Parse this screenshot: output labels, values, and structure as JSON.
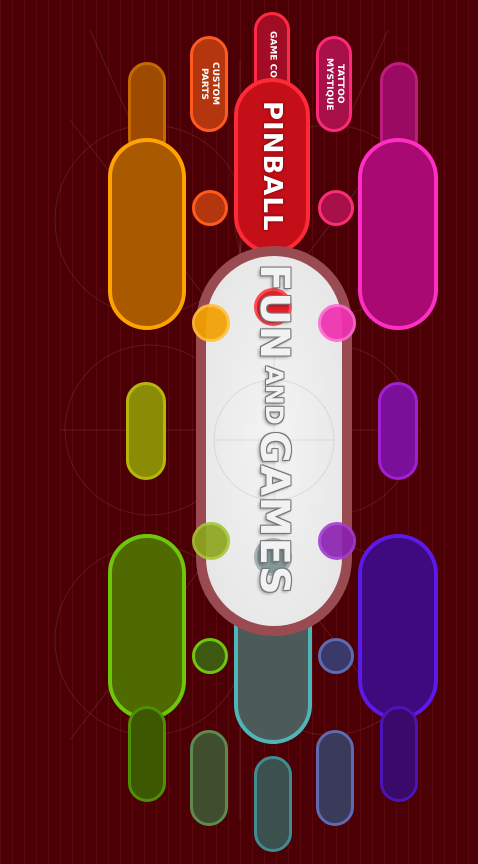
{
  "menu": {
    "custom_parts": "CUSTOM\nPARTS",
    "game_code": "GAME CODE",
    "tattoo_mystique": "TATTOO\nMYSTIQUE",
    "pinball": "PINBALL"
  },
  "title": {
    "fun": "FUN",
    "and": "AND",
    "games": "GAMES"
  },
  "colors": {
    "background": "#4a0005",
    "orange": "#ff9a00",
    "red": "#e21f2a",
    "magenta": "#ff2fb0",
    "yellow_green": "#b5b80a",
    "purple": "#a21fd2",
    "green": "#6dc70a",
    "teal": "#4fb6b8",
    "violet": "#5d19e8",
    "sage": "#7a9a6a",
    "slate_blue": "#5f6ab0"
  },
  "icons": [
    "flipper-shapes",
    "bumper-dots"
  ]
}
